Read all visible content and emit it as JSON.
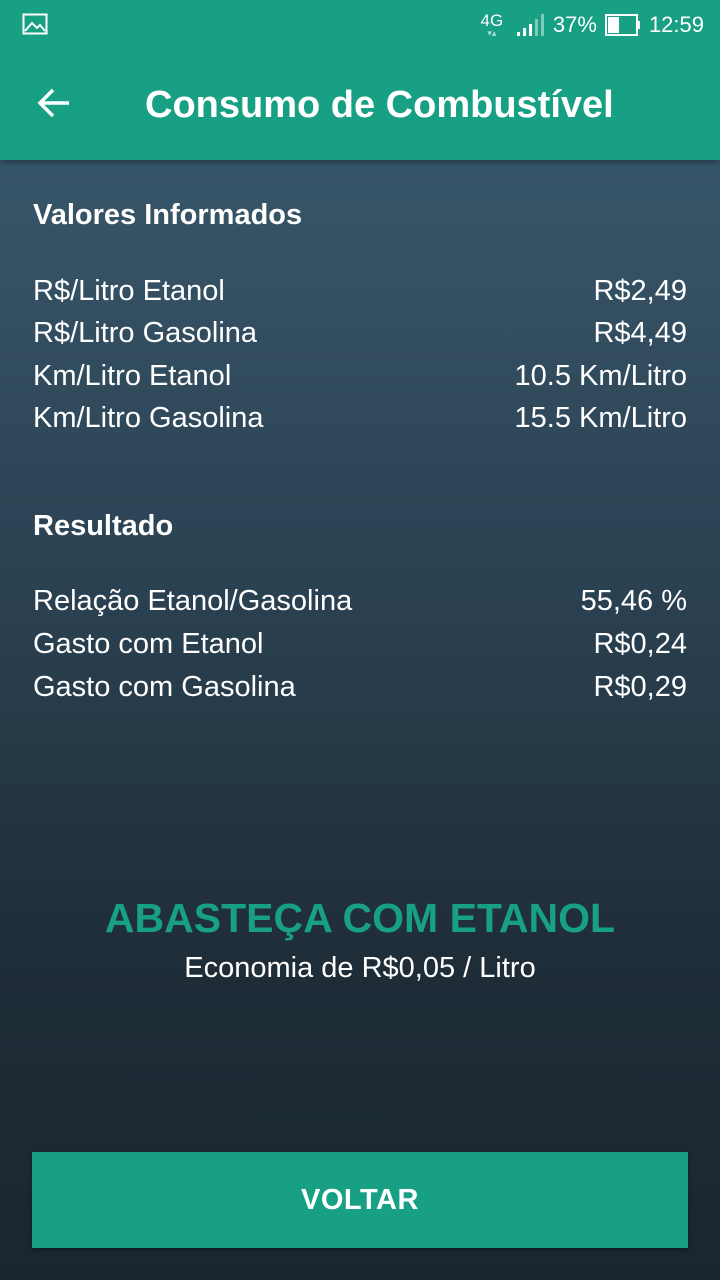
{
  "status_bar": {
    "notification_icon": "image-icon",
    "network_type": "4G",
    "signal_icon": "cell-signal-icon",
    "battery_percent": "37%",
    "battery_icon": "battery-icon",
    "time": "12:59"
  },
  "app_bar": {
    "back_icon": "arrow-left-icon",
    "title": "Consumo de Combustível"
  },
  "informed_values": {
    "title": "Valores Informados",
    "rows": [
      {
        "label": "R$/Litro Etanol",
        "value": "R$2,49"
      },
      {
        "label": "R$/Litro Gasolina",
        "value": "R$4,49"
      },
      {
        "label": "Km/Litro Etanol",
        "value": "10.5 Km/Litro"
      },
      {
        "label": "Km/Litro Gasolina",
        "value": "15.5 Km/Litro"
      }
    ]
  },
  "result": {
    "title": "Resultado",
    "rows": [
      {
        "label": "Relação Etanol/Gasolina",
        "value": "55,46 %"
      },
      {
        "label": "Gasto com Etanol",
        "value": "R$0,24"
      },
      {
        "label": "Gasto com Gasolina",
        "value": "R$0,29"
      }
    ]
  },
  "recommendation": {
    "verdict": "ABASTEÇA COM ETANOL",
    "savings": "Economia de R$0,05 / Litro"
  },
  "actions": {
    "back_label": "VOLTAR"
  },
  "colors": {
    "accent": "#17a084",
    "text": "#ffffff"
  }
}
